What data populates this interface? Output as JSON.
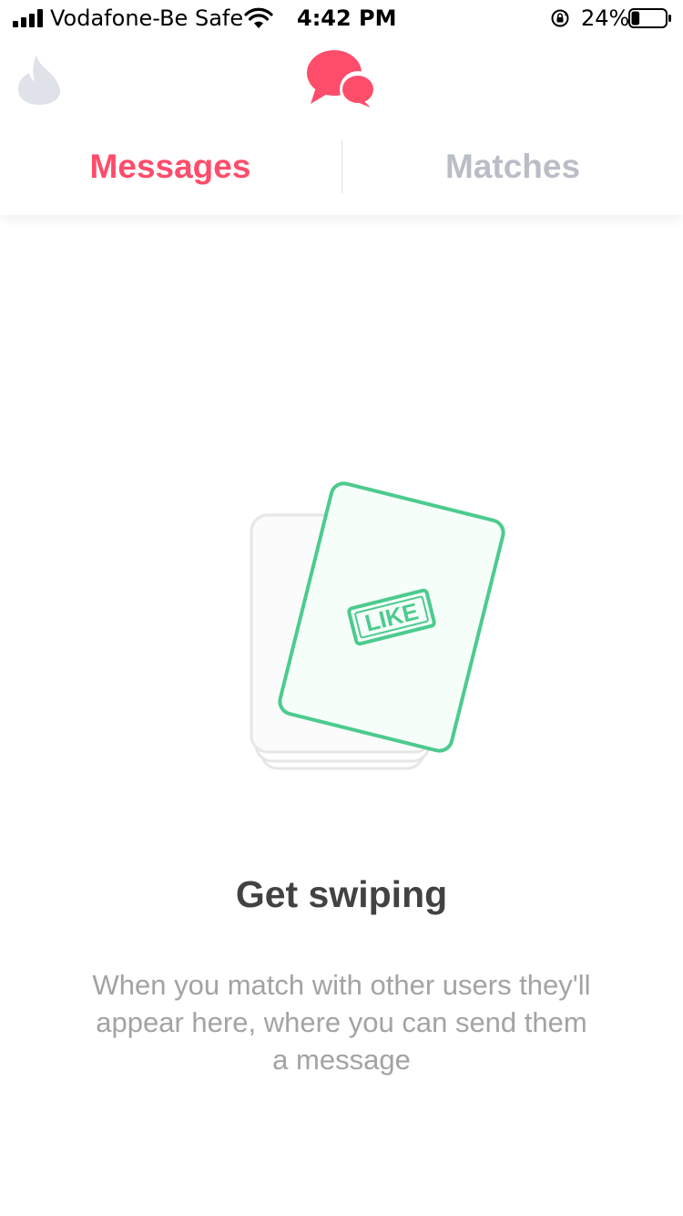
{
  "status_bar": {
    "carrier": "Vodafone-Be Safe",
    "time": "4:42 PM",
    "battery_percent": "24%",
    "battery_level": 0.24,
    "signal_icon": "signal-bars-icon",
    "wifi_icon": "wifi-icon",
    "orientation_lock_icon": "orientation-lock-icon"
  },
  "top_nav": {
    "left_icon": "flame-icon",
    "center_icon": "chat-bubbles-icon"
  },
  "tabs": [
    {
      "label": "Messages",
      "active": true
    },
    {
      "label": "Matches",
      "active": false
    }
  ],
  "empty_state": {
    "illustration_label": "LIKE",
    "title": "Get swiping",
    "description": "When you match with other users they'll appear here, where you can send them a message"
  },
  "colors": {
    "accent": "#fd4d6b",
    "inactive_tab": "#b9bdc6",
    "like_green": "#4ccb8e",
    "title_text": "#424242",
    "body_text": "#a3a3a3"
  }
}
